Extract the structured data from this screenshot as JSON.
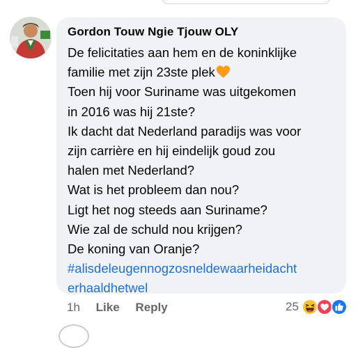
{
  "comment": {
    "author": "Gordon Touw Ngie Tjouw OLY",
    "lines": [
      "De felicitaties aan hem en de koninklijke",
      "familie met zijn 23ste plek",
      "Toen hij voor Suriname was uitgekomen",
      "in 2016 was hij 21ste?",
      "Ik dacht dat Nederland paradijs was voor",
      "zijn carrière en hij eindelijk goud zou",
      "halen met Nederland?",
      "Wat is het probleem dan nou?",
      "Ligt het nog steeds aan Suriname?",
      "Wie zal de schuld nou krijgen?",
      "De koning van Oranje?"
    ],
    "hashtag_lines": [
      "#alisdeleugennogzosneldewaarheidacht",
      "erhaaldhetwel"
    ],
    "emoji": "orange-heart-icon"
  },
  "actions": {
    "time": "1h",
    "like": "Like",
    "reply": "Reply"
  },
  "reactions": {
    "count": "25",
    "icons": [
      "haha-icon",
      "love-icon",
      "like-icon"
    ]
  },
  "colors": {
    "bubble": "#f0f2f5",
    "hashtag": "#216fdb",
    "meta": "#65676b",
    "text": "#050505"
  }
}
